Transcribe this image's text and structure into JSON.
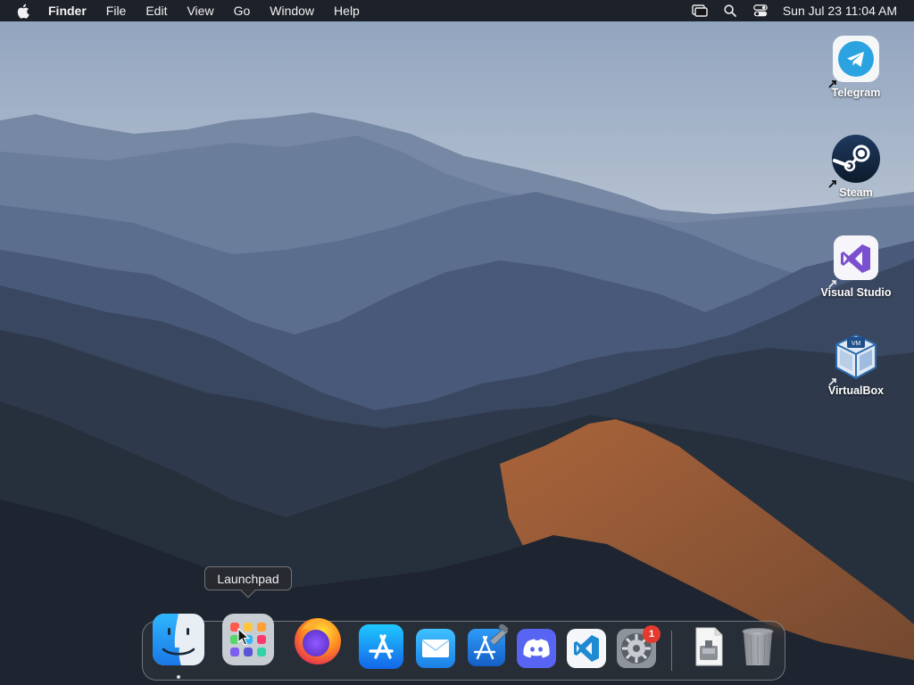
{
  "menubar": {
    "app_name": "Finder",
    "menus": [
      "File",
      "Edit",
      "View",
      "Go",
      "Window",
      "Help"
    ],
    "clock": "Sun Jul 23  11:04 AM",
    "status_icons": [
      "screen-mirroring-icon",
      "spotlight-search-icon",
      "control-center-icon"
    ]
  },
  "desktop": {
    "icons": [
      {
        "label": "Telegram",
        "icon": "telegram-icon",
        "color": "#2aa3e0"
      },
      {
        "label": "Steam",
        "icon": "steam-icon",
        "color": "#1b2838"
      },
      {
        "label": "Visual Studio",
        "icon": "visual-studio-icon",
        "color": "#7a4fd0"
      },
      {
        "label": "VirtualBox",
        "icon": "virtualbox-icon",
        "color": "#2b6cb0"
      }
    ]
  },
  "tooltip": {
    "text": "Launchpad"
  },
  "dock": {
    "items": [
      {
        "name": "Finder",
        "icon": "finder-icon",
        "running": true
      },
      {
        "name": "Launchpad",
        "icon": "launchpad-icon"
      },
      {
        "name": "Firefox",
        "icon": "firefox-icon"
      },
      {
        "name": "App Store",
        "icon": "app-store-icon"
      },
      {
        "name": "Mail",
        "icon": "mail-icon"
      },
      {
        "name": "Xcode",
        "icon": "xcode-icon"
      },
      {
        "name": "Discord",
        "icon": "discord-icon"
      },
      {
        "name": "Visual Studio Code",
        "icon": "vscode-icon"
      },
      {
        "name": "System Settings",
        "icon": "system-settings-icon",
        "badge": "1"
      },
      {
        "name": "Downloads",
        "icon": "downloads-stack-icon"
      },
      {
        "name": "Trash",
        "icon": "trash-icon"
      }
    ]
  }
}
